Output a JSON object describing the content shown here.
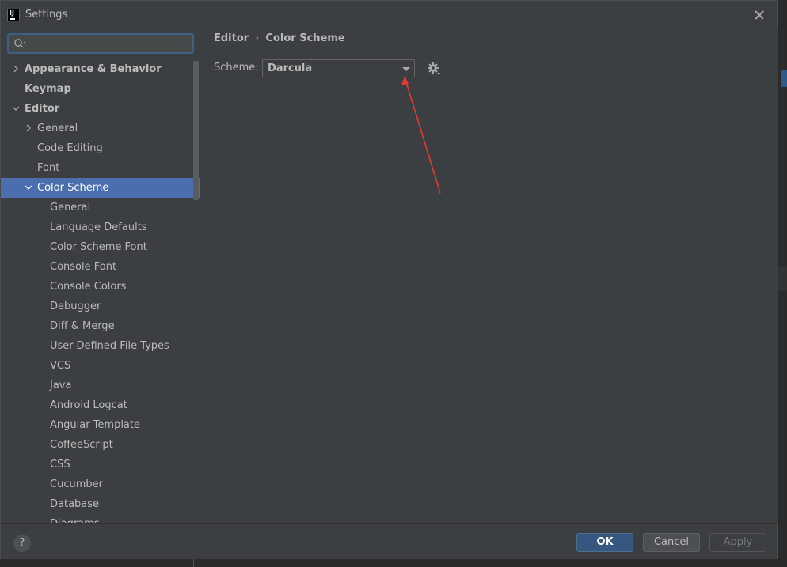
{
  "window": {
    "title": "Settings"
  },
  "search": {
    "placeholder": "",
    "value": ""
  },
  "breadcrumb": {
    "parent": "Editor",
    "separator": "›",
    "current": "Color Scheme"
  },
  "scheme": {
    "label": "Scheme:",
    "value": "Darcula"
  },
  "tree": [
    {
      "label": "Appearance & Behavior",
      "level": 0,
      "bold": true,
      "arrow": "right"
    },
    {
      "label": "Keymap",
      "level": 0,
      "bold": true,
      "arrow": "none"
    },
    {
      "label": "Editor",
      "level": 0,
      "bold": true,
      "arrow": "down"
    },
    {
      "label": "General",
      "level": 1,
      "bold": false,
      "arrow": "right"
    },
    {
      "label": "Code Editing",
      "level": 1,
      "bold": false,
      "arrow": "none"
    },
    {
      "label": "Font",
      "level": 1,
      "bold": false,
      "arrow": "none"
    },
    {
      "label": "Color Scheme",
      "level": 1,
      "bold": false,
      "arrow": "down",
      "selected": true
    },
    {
      "label": "General",
      "level": 2,
      "bold": false,
      "arrow": "none"
    },
    {
      "label": "Language Defaults",
      "level": 2,
      "bold": false,
      "arrow": "none"
    },
    {
      "label": "Color Scheme Font",
      "level": 2,
      "bold": false,
      "arrow": "none"
    },
    {
      "label": "Console Font",
      "level": 2,
      "bold": false,
      "arrow": "none"
    },
    {
      "label": "Console Colors",
      "level": 2,
      "bold": false,
      "arrow": "none"
    },
    {
      "label": "Debugger",
      "level": 2,
      "bold": false,
      "arrow": "none"
    },
    {
      "label": "Diff & Merge",
      "level": 2,
      "bold": false,
      "arrow": "none"
    },
    {
      "label": "User-Defined File Types",
      "level": 2,
      "bold": false,
      "arrow": "none"
    },
    {
      "label": "VCS",
      "level": 2,
      "bold": false,
      "arrow": "none"
    },
    {
      "label": "Java",
      "level": 2,
      "bold": false,
      "arrow": "none"
    },
    {
      "label": "Android Logcat",
      "level": 2,
      "bold": false,
      "arrow": "none"
    },
    {
      "label": "Angular Template",
      "level": 2,
      "bold": false,
      "arrow": "none"
    },
    {
      "label": "CoffeeScript",
      "level": 2,
      "bold": false,
      "arrow": "none"
    },
    {
      "label": "CSS",
      "level": 2,
      "bold": false,
      "arrow": "none"
    },
    {
      "label": "Cucumber",
      "level": 2,
      "bold": false,
      "arrow": "none"
    },
    {
      "label": "Database",
      "level": 2,
      "bold": false,
      "arrow": "none"
    },
    {
      "label": "Diagrams",
      "level": 2,
      "bold": false,
      "arrow": "none"
    }
  ],
  "footer": {
    "help_label": "?",
    "ok_label": "OK",
    "cancel_label": "Cancel",
    "apply_label": "Apply"
  },
  "colors": {
    "selection": "#4b6eaf",
    "background": "#3c3f41",
    "annotation_arrow": "#e53935",
    "ok_button": "#365880"
  }
}
